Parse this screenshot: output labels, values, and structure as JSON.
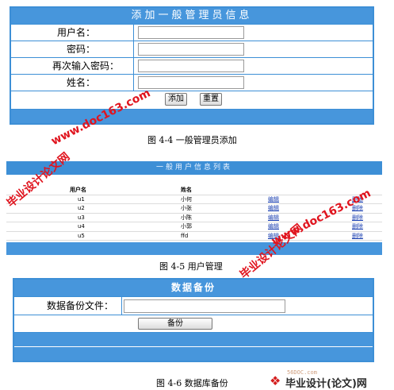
{
  "add_admin": {
    "title": "添加一般管理员信息",
    "fields": [
      {
        "label": "用户名：",
        "value": ""
      },
      {
        "label": "密码：",
        "value": ""
      },
      {
        "label": "再次输入密码：",
        "value": ""
      },
      {
        "label": "姓名：",
        "value": ""
      }
    ],
    "add_label": "添加",
    "reset_label": "重置",
    "caption": "图 4-4  一般管理员添加"
  },
  "user_list": {
    "title": "一般用户信息列表",
    "headers": [
      "用户名",
      "姓名"
    ],
    "rows": [
      {
        "username": "u1",
        "name": "小何",
        "edit": "编辑",
        "delete": "删除"
      },
      {
        "username": "u2",
        "name": "小张",
        "edit": "编辑",
        "delete": "删除"
      },
      {
        "username": "u3",
        "name": "小陈",
        "edit": "编辑",
        "delete": "删除"
      },
      {
        "username": "u4",
        "name": "小郭",
        "edit": "编辑",
        "delete": "删除"
      },
      {
        "username": "u5",
        "name": "ffd",
        "edit": "编辑",
        "delete": "删除"
      }
    ],
    "caption": "图 4-5  用户管理"
  },
  "backup": {
    "title": "数据备份",
    "file_label": "数据备份文件：",
    "file_value": "",
    "backup_label": "备份",
    "caption": "图 4-6  数据库备份"
  },
  "watermarks": {
    "url": "www.doc163.com",
    "site_name": "毕业设计论文网",
    "footer_logo": "毕业设计(论文)网",
    "footer_domain": "56DOC.com"
  },
  "colors": {
    "panel_blue": "#4796dc",
    "border_blue": "#3d8fd6",
    "watermark_red": "#e0141e",
    "link_blue": "#1a3fb0"
  }
}
